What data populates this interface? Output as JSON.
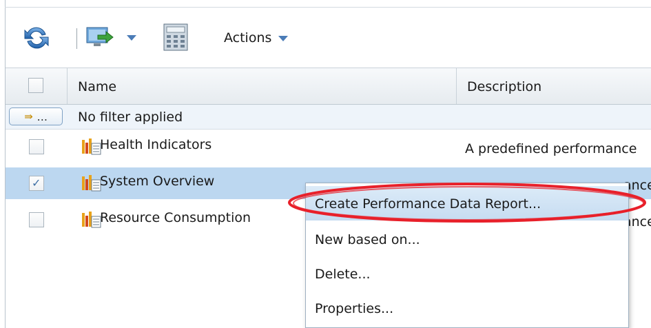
{
  "toolbar": {
    "actions_label": "Actions",
    "icons": [
      "refresh-icon",
      "export-icon",
      "calculator-icon",
      "chevron-down-icon"
    ]
  },
  "table": {
    "columns": [
      "Name",
      "Description"
    ],
    "filter_button_label": "...",
    "filter_text": "No filter applied",
    "rows": [
      {
        "name": "Health Indicators",
        "description": "A predefined performance",
        "checked": false
      },
      {
        "name": "System Overview",
        "description": "ance",
        "checked": true
      },
      {
        "name": "Resource Consumption",
        "description": "ance",
        "checked": false
      }
    ]
  },
  "context_menu": {
    "items": [
      {
        "label": "Create Performance Data Report..."
      },
      {
        "label": "New based on..."
      },
      {
        "label": "Delete..."
      },
      {
        "label": "Properties..."
      }
    ]
  },
  "colors": {
    "selected_row": "#bcd7f0",
    "annotation": "#e8202a",
    "accent": "#4b7cb7"
  }
}
